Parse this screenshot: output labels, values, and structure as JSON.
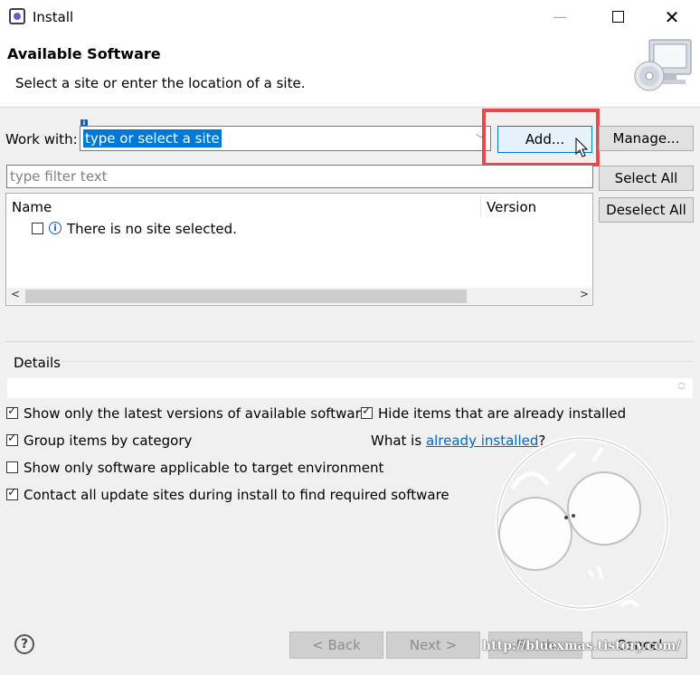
{
  "window": {
    "title": "Install",
    "close_glyph": "✕"
  },
  "header": {
    "title": "Available Software",
    "subtitle": "Select a site or enter the location of a site."
  },
  "work_with": {
    "label": "Work with:",
    "value": "type or select a site",
    "add_label": "Add...",
    "manage_label": "Manage..."
  },
  "filter": {
    "placeholder": "type filter text"
  },
  "table": {
    "columns": [
      "Name",
      "Version"
    ],
    "rows": [
      {
        "name": "There is no site selected.",
        "checked": false
      }
    ]
  },
  "selection": {
    "select_all": "Select All",
    "deselect_all": "Deselect All"
  },
  "details": {
    "label": "Details"
  },
  "options": {
    "latest_versions": "Show only the latest versions of available software",
    "hide_installed": "Hide items that are already installed",
    "group_by_category": "Group items by category",
    "what_is_prefix": "What is ",
    "what_is_link": "already installed",
    "what_is_suffix": "?",
    "target_env": "Show only software applicable to target environment",
    "contact_sites": "Contact all update sites during install to find required software"
  },
  "footer": {
    "help": "?",
    "back": "< Back",
    "next": "Next >",
    "finish": "Finish",
    "cancel": "Cancel"
  },
  "watermark_text": "http://bluexmas.tistory.com/",
  "colors": {
    "highlight": "#e8474b",
    "selection": "#0078d7",
    "link": "#0066cc"
  }
}
